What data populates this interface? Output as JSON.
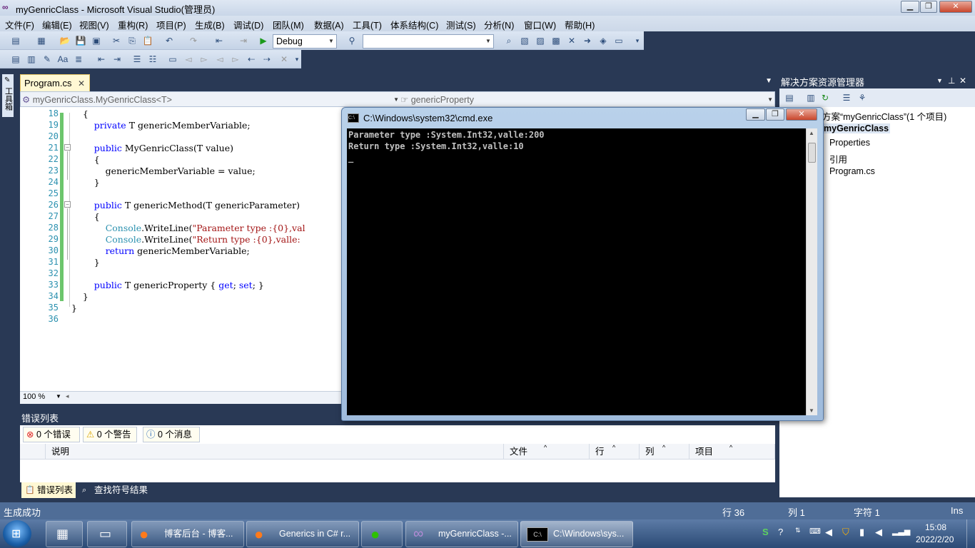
{
  "window": {
    "title": "myGenricClass - Microsoft Visual Studio(管理员)",
    "minimize": "▁",
    "maximize": "❐",
    "close": "✕"
  },
  "menu": [
    "文件(F)",
    "编辑(E)",
    "视图(V)",
    "重构(R)",
    "项目(P)",
    "生成(B)",
    "调试(D)",
    "团队(M)",
    "数据(A)",
    "工具(T)",
    "体系结构(C)",
    "测试(S)",
    "分析(N)",
    "窗口(W)",
    "帮助(H)"
  ],
  "toolbar": {
    "config": "Debug",
    "search_value": ""
  },
  "left_strip": {
    "toolbox_label": "工具箱"
  },
  "editor": {
    "tab_label": "Program.cs",
    "tab_close": "✕",
    "nav_left": "myGenricClass.MyGenricClass<T>",
    "nav_right": "genericProperty",
    "zoom": "100 %",
    "lines": [
      {
        "num": "18",
        "code": "    {"
      },
      {
        "num": "19",
        "code": "        private T genericMemberVariable;"
      },
      {
        "num": "20",
        "code": ""
      },
      {
        "num": "21",
        "code": "        public MyGenricClass(T value)"
      },
      {
        "num": "22",
        "code": "        {"
      },
      {
        "num": "23",
        "code": "            genericMemberVariable = value;"
      },
      {
        "num": "24",
        "code": "        }"
      },
      {
        "num": "25",
        "code": ""
      },
      {
        "num": "26",
        "code": "        public T genericMethod(T genericParameter)"
      },
      {
        "num": "27",
        "code": "        {"
      },
      {
        "num": "28",
        "code": "            Console.WriteLine(\"Parameter type :{0},val"
      },
      {
        "num": "29",
        "code": "            Console.WriteLine(\"Return type :{0},valle:"
      },
      {
        "num": "30",
        "code": "            return genericMemberVariable;"
      },
      {
        "num": "31",
        "code": "        }"
      },
      {
        "num": "32",
        "code": ""
      },
      {
        "num": "33",
        "code": "        public T genericProperty { get; set; }"
      },
      {
        "num": "34",
        "code": "    }"
      },
      {
        "num": "35",
        "code": "}"
      },
      {
        "num": "36",
        "code": ""
      }
    ]
  },
  "cmd": {
    "title": "C:\\Windows\\system32\\cmd.exe",
    "output": [
      "Parameter type :System.Int32,valle:200",
      "Return type :System.Int32,valle:10",
      "_"
    ]
  },
  "error_list": {
    "title": "错误列表",
    "errors": "0 个错误",
    "warnings": "0 个警告",
    "messages": "0 个消息",
    "columns": [
      "说明",
      "文件",
      "行",
      "列",
      "项目"
    ],
    "tabs": [
      "错误列表",
      "查找符号结果"
    ]
  },
  "solution_explorer": {
    "title": "解决方案资源管理器",
    "solution": "方案“myGenricClass”(1 个项目)",
    "project": "myGenricClass",
    "items": [
      "Properties",
      "引用",
      "Program.cs"
    ]
  },
  "status": {
    "message": "生成成功",
    "row": "行 36",
    "col": "列 1",
    "char": "字符 1",
    "mode": "Ins"
  },
  "taskbar": {
    "buttons": [
      "博客后台 - 博客...",
      "Generics in C# r...",
      "",
      "myGenricClass -...",
      "C:\\Windows\\sys..."
    ],
    "time": "15:08",
    "date": "2022/2/20"
  }
}
